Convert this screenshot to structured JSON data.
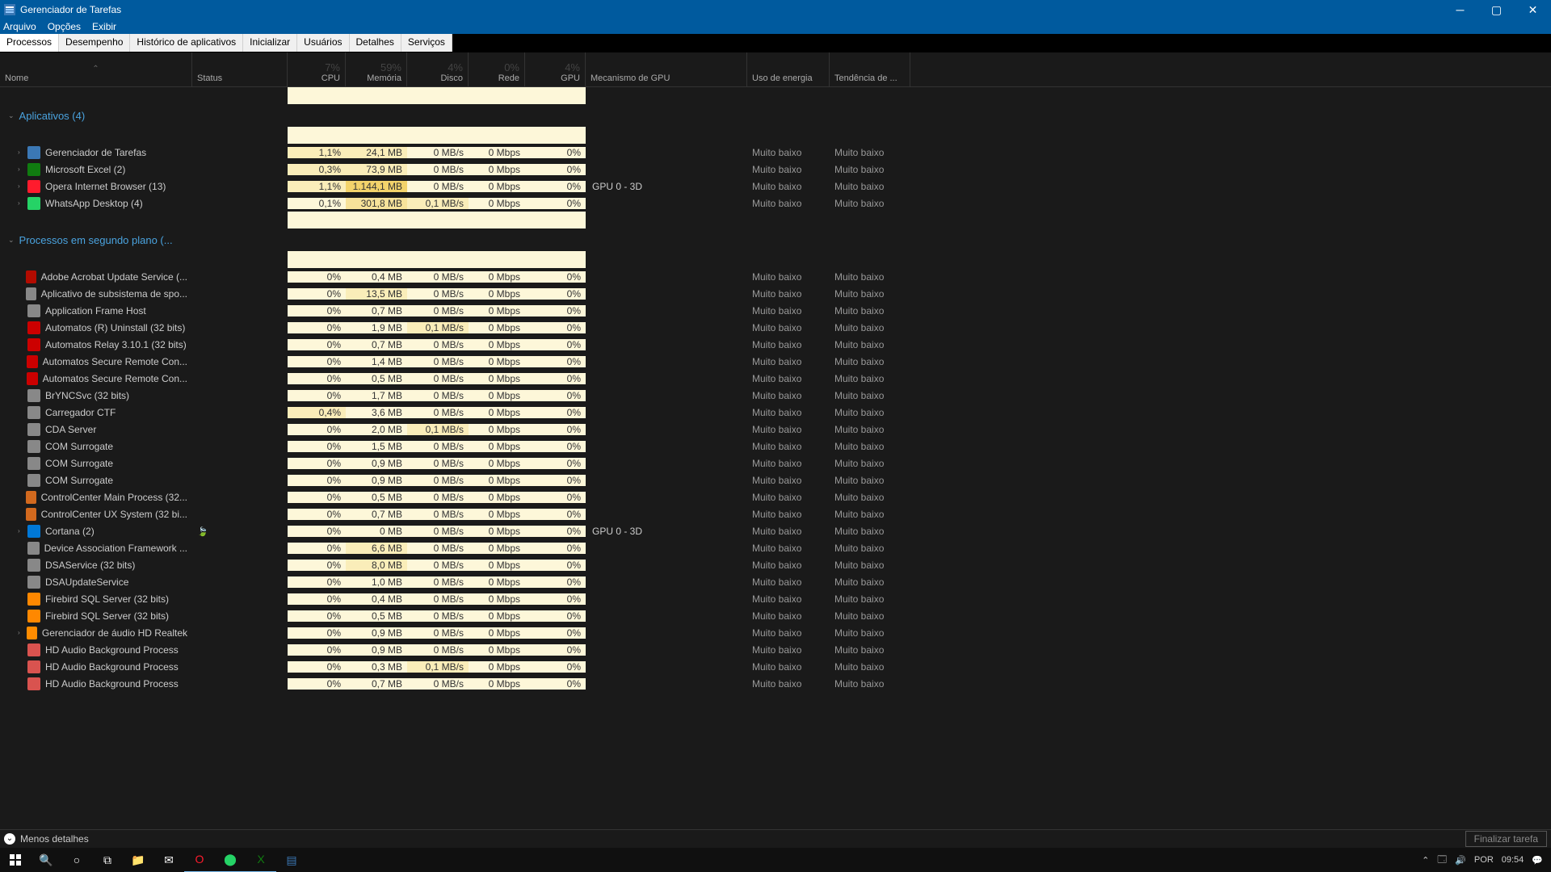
{
  "window": {
    "title": "Gerenciador de Tarefas",
    "menu": [
      "Arquivo",
      "Opções",
      "Exibir"
    ],
    "tabs": [
      "Processos",
      "Desempenho",
      "Histórico de aplicativos",
      "Inicializar",
      "Usuários",
      "Detalhes",
      "Serviços"
    ]
  },
  "columns": {
    "name": "Nome",
    "status": "Status",
    "cpu": {
      "pct": "7%",
      "label": "CPU"
    },
    "mem": {
      "pct": "59%",
      "label": "Memória"
    },
    "disk": {
      "pct": "4%",
      "label": "Disco"
    },
    "net": {
      "pct": "0%",
      "label": "Rede"
    },
    "gpu": {
      "pct": "4%",
      "label": "GPU"
    },
    "engine": "Mecanismo de GPU",
    "power": "Uso de energia",
    "trend": "Tendência de ..."
  },
  "groups": [
    {
      "title": "Aplicativos (4)",
      "rows": [
        {
          "exp": true,
          "icon": "#3b78b5",
          "name": "Gerenciador de Tarefas",
          "cpu": "1,1%",
          "ch": 2,
          "mem": "24,1 MB",
          "mh": 2,
          "disk": "0 MB/s",
          "dh": 1,
          "net": "0 Mbps",
          "nh": 1,
          "gpu": "0%",
          "gh": 1,
          "eng": "",
          "pow": "Muito baixo",
          "trend": "Muito baixo"
        },
        {
          "exp": true,
          "icon": "#107c10",
          "name": "Microsoft Excel (2)",
          "cpu": "0,3%",
          "ch": 2,
          "mem": "73,9 MB",
          "mh": 2,
          "disk": "0 MB/s",
          "dh": 1,
          "net": "0 Mbps",
          "nh": 1,
          "gpu": "0%",
          "gh": 1,
          "eng": "",
          "pow": "Muito baixo",
          "trend": "Muito baixo"
        },
        {
          "exp": true,
          "icon": "#ff1b2d",
          "name": "Opera Internet Browser (13)",
          "cpu": "1,1%",
          "ch": 2,
          "mem": "1.144,1 MB",
          "mh": 4,
          "disk": "0 MB/s",
          "dh": 1,
          "net": "0 Mbps",
          "nh": 1,
          "gpu": "0%",
          "gh": 1,
          "eng": "GPU 0 - 3D",
          "pow": "Muito baixo",
          "trend": "Muito baixo"
        },
        {
          "exp": true,
          "icon": "#25d366",
          "name": "WhatsApp Desktop (4)",
          "cpu": "0,1%",
          "ch": 1,
          "mem": "301,8 MB",
          "mh": 3,
          "disk": "0,1 MB/s",
          "dh": 2,
          "net": "0 Mbps",
          "nh": 1,
          "gpu": "0%",
          "gh": 1,
          "eng": "",
          "pow": "Muito baixo",
          "trend": "Muito baixo"
        }
      ]
    },
    {
      "title": "Processos em segundo plano (...",
      "rows": [
        {
          "icon": "#b30b00",
          "name": "Adobe Acrobat Update Service (...",
          "cpu": "0%",
          "ch": 1,
          "mem": "0,4 MB",
          "mh": 1,
          "disk": "0 MB/s",
          "dh": 1,
          "net": "0 Mbps",
          "nh": 1,
          "gpu": "0%",
          "gh": 1,
          "eng": "",
          "pow": "Muito baixo",
          "trend": "Muito baixo"
        },
        {
          "icon": "#888",
          "name": "Aplicativo de subsistema de spo...",
          "cpu": "0%",
          "ch": 1,
          "mem": "13,5 MB",
          "mh": 2,
          "disk": "0 MB/s",
          "dh": 1,
          "net": "0 Mbps",
          "nh": 1,
          "gpu": "0%",
          "gh": 1,
          "eng": "",
          "pow": "Muito baixo",
          "trend": "Muito baixo"
        },
        {
          "icon": "#888",
          "name": "Application Frame Host",
          "cpu": "0%",
          "ch": 1,
          "mem": "0,7 MB",
          "mh": 1,
          "disk": "0 MB/s",
          "dh": 1,
          "net": "0 Mbps",
          "nh": 1,
          "gpu": "0%",
          "gh": 1,
          "eng": "",
          "pow": "Muito baixo",
          "trend": "Muito baixo"
        },
        {
          "icon": "#c00",
          "name": "Automatos (R) Uninstall (32 bits)",
          "cpu": "0%",
          "ch": 1,
          "mem": "1,9 MB",
          "mh": 1,
          "disk": "0,1 MB/s",
          "dh": 2,
          "net": "0 Mbps",
          "nh": 1,
          "gpu": "0%",
          "gh": 1,
          "eng": "",
          "pow": "Muito baixo",
          "trend": "Muito baixo"
        },
        {
          "icon": "#c00",
          "name": "Automatos Relay 3.10.1 (32 bits)",
          "cpu": "0%",
          "ch": 1,
          "mem": "0,7 MB",
          "mh": 1,
          "disk": "0 MB/s",
          "dh": 1,
          "net": "0 Mbps",
          "nh": 1,
          "gpu": "0%",
          "gh": 1,
          "eng": "",
          "pow": "Muito baixo",
          "trend": "Muito baixo"
        },
        {
          "icon": "#c00",
          "name": "Automatos Secure Remote Con...",
          "cpu": "0%",
          "ch": 1,
          "mem": "1,4 MB",
          "mh": 1,
          "disk": "0 MB/s",
          "dh": 1,
          "net": "0 Mbps",
          "nh": 1,
          "gpu": "0%",
          "gh": 1,
          "eng": "",
          "pow": "Muito baixo",
          "trend": "Muito baixo"
        },
        {
          "icon": "#c00",
          "name": "Automatos Secure Remote Con...",
          "cpu": "0%",
          "ch": 1,
          "mem": "0,5 MB",
          "mh": 1,
          "disk": "0 MB/s",
          "dh": 1,
          "net": "0 Mbps",
          "nh": 1,
          "gpu": "0%",
          "gh": 1,
          "eng": "",
          "pow": "Muito baixo",
          "trend": "Muito baixo"
        },
        {
          "icon": "#888",
          "name": "BrYNCSvc (32 bits)",
          "cpu": "0%",
          "ch": 1,
          "mem": "1,7 MB",
          "mh": 1,
          "disk": "0 MB/s",
          "dh": 1,
          "net": "0 Mbps",
          "nh": 1,
          "gpu": "0%",
          "gh": 1,
          "eng": "",
          "pow": "Muito baixo",
          "trend": "Muito baixo"
        },
        {
          "icon": "#888",
          "name": "Carregador CTF",
          "cpu": "0,4%",
          "ch": 2,
          "mem": "3,6 MB",
          "mh": 1,
          "disk": "0 MB/s",
          "dh": 1,
          "net": "0 Mbps",
          "nh": 1,
          "gpu": "0%",
          "gh": 1,
          "eng": "",
          "pow": "Muito baixo",
          "trend": "Muito baixo"
        },
        {
          "icon": "#888",
          "name": "CDA Server",
          "cpu": "0%",
          "ch": 1,
          "mem": "2,0 MB",
          "mh": 1,
          "disk": "0,1 MB/s",
          "dh": 2,
          "net": "0 Mbps",
          "nh": 1,
          "gpu": "0%",
          "gh": 1,
          "eng": "",
          "pow": "Muito baixo",
          "trend": "Muito baixo"
        },
        {
          "icon": "#888",
          "name": "COM Surrogate",
          "cpu": "0%",
          "ch": 1,
          "mem": "1,5 MB",
          "mh": 1,
          "disk": "0 MB/s",
          "dh": 1,
          "net": "0 Mbps",
          "nh": 1,
          "gpu": "0%",
          "gh": 1,
          "eng": "",
          "pow": "Muito baixo",
          "trend": "Muito baixo"
        },
        {
          "icon": "#888",
          "name": "COM Surrogate",
          "cpu": "0%",
          "ch": 1,
          "mem": "0,9 MB",
          "mh": 1,
          "disk": "0 MB/s",
          "dh": 1,
          "net": "0 Mbps",
          "nh": 1,
          "gpu": "0%",
          "gh": 1,
          "eng": "",
          "pow": "Muito baixo",
          "trend": "Muito baixo"
        },
        {
          "icon": "#888",
          "name": "COM Surrogate",
          "cpu": "0%",
          "ch": 1,
          "mem": "0,9 MB",
          "mh": 1,
          "disk": "0 MB/s",
          "dh": 1,
          "net": "0 Mbps",
          "nh": 1,
          "gpu": "0%",
          "gh": 1,
          "eng": "",
          "pow": "Muito baixo",
          "trend": "Muito baixo"
        },
        {
          "icon": "#d2691e",
          "name": "ControlCenter Main Process (32...",
          "cpu": "0%",
          "ch": 1,
          "mem": "0,5 MB",
          "mh": 1,
          "disk": "0 MB/s",
          "dh": 1,
          "net": "0 Mbps",
          "nh": 1,
          "gpu": "0%",
          "gh": 1,
          "eng": "",
          "pow": "Muito baixo",
          "trend": "Muito baixo"
        },
        {
          "icon": "#d2691e",
          "name": "ControlCenter UX System (32 bi...",
          "cpu": "0%",
          "ch": 1,
          "mem": "0,7 MB",
          "mh": 1,
          "disk": "0 MB/s",
          "dh": 1,
          "net": "0 Mbps",
          "nh": 1,
          "gpu": "0%",
          "gh": 1,
          "eng": "",
          "pow": "Muito baixo",
          "trend": "Muito baixo"
        },
        {
          "exp": true,
          "icon": "#0078d7",
          "name": "Cortana (2)",
          "leaf": true,
          "cpu": "0%",
          "ch": 1,
          "mem": "0 MB",
          "mh": 1,
          "disk": "0 MB/s",
          "dh": 1,
          "net": "0 Mbps",
          "nh": 1,
          "gpu": "0%",
          "gh": 1,
          "eng": "GPU 0 - 3D",
          "pow": "Muito baixo",
          "trend": "Muito baixo"
        },
        {
          "icon": "#888",
          "name": "Device Association Framework ...",
          "cpu": "0%",
          "ch": 1,
          "mem": "6,6 MB",
          "mh": 2,
          "disk": "0 MB/s",
          "dh": 1,
          "net": "0 Mbps",
          "nh": 1,
          "gpu": "0%",
          "gh": 1,
          "eng": "",
          "pow": "Muito baixo",
          "trend": "Muito baixo"
        },
        {
          "icon": "#888",
          "name": "DSAService (32 bits)",
          "cpu": "0%",
          "ch": 1,
          "mem": "8,0 MB",
          "mh": 2,
          "disk": "0 MB/s",
          "dh": 1,
          "net": "0 Mbps",
          "nh": 1,
          "gpu": "0%",
          "gh": 1,
          "eng": "",
          "pow": "Muito baixo",
          "trend": "Muito baixo"
        },
        {
          "icon": "#888",
          "name": "DSAUpdateService",
          "cpu": "0%",
          "ch": 1,
          "mem": "1,0 MB",
          "mh": 1,
          "disk": "0 MB/s",
          "dh": 1,
          "net": "0 Mbps",
          "nh": 1,
          "gpu": "0%",
          "gh": 1,
          "eng": "",
          "pow": "Muito baixo",
          "trend": "Muito baixo"
        },
        {
          "icon": "#f80",
          "name": "Firebird SQL Server (32 bits)",
          "cpu": "0%",
          "ch": 1,
          "mem": "0,4 MB",
          "mh": 1,
          "disk": "0 MB/s",
          "dh": 1,
          "net": "0 Mbps",
          "nh": 1,
          "gpu": "0%",
          "gh": 1,
          "eng": "",
          "pow": "Muito baixo",
          "trend": "Muito baixo"
        },
        {
          "icon": "#f80",
          "name": "Firebird SQL Server (32 bits)",
          "cpu": "0%",
          "ch": 1,
          "mem": "0,5 MB",
          "mh": 1,
          "disk": "0 MB/s",
          "dh": 1,
          "net": "0 Mbps",
          "nh": 1,
          "gpu": "0%",
          "gh": 1,
          "eng": "",
          "pow": "Muito baixo",
          "trend": "Muito baixo"
        },
        {
          "exp": true,
          "icon": "#ff8c00",
          "name": "Gerenciador de áudio HD Realtek",
          "cpu": "0%",
          "ch": 1,
          "mem": "0,9 MB",
          "mh": 1,
          "disk": "0 MB/s",
          "dh": 1,
          "net": "0 Mbps",
          "nh": 1,
          "gpu": "0%",
          "gh": 1,
          "eng": "",
          "pow": "Muito baixo",
          "trend": "Muito baixo"
        },
        {
          "icon": "#d9534f",
          "name": "HD Audio Background Process",
          "cpu": "0%",
          "ch": 1,
          "mem": "0,9 MB",
          "mh": 1,
          "disk": "0 MB/s",
          "dh": 1,
          "net": "0 Mbps",
          "nh": 1,
          "gpu": "0%",
          "gh": 1,
          "eng": "",
          "pow": "Muito baixo",
          "trend": "Muito baixo"
        },
        {
          "icon": "#d9534f",
          "name": "HD Audio Background Process",
          "cpu": "0%",
          "ch": 1,
          "mem": "0,3 MB",
          "mh": 1,
          "disk": "0,1 MB/s",
          "dh": 2,
          "net": "0 Mbps",
          "nh": 1,
          "gpu": "0%",
          "gh": 1,
          "eng": "",
          "pow": "Muito baixo",
          "trend": "Muito baixo"
        },
        {
          "icon": "#d9534f",
          "name": "HD Audio Background Process",
          "cpu": "0%",
          "ch": 1,
          "mem": "0,7 MB",
          "mh": 1,
          "disk": "0 MB/s",
          "dh": 1,
          "net": "0 Mbps",
          "nh": 1,
          "gpu": "0%",
          "gh": 1,
          "eng": "",
          "pow": "Muito baixo",
          "trend": "Muito baixo"
        }
      ]
    }
  ],
  "footer": {
    "less": "Menos detalhes",
    "end": "Finalizar tarefa"
  },
  "tray": {
    "lang": "POR",
    "time": "09:54"
  }
}
